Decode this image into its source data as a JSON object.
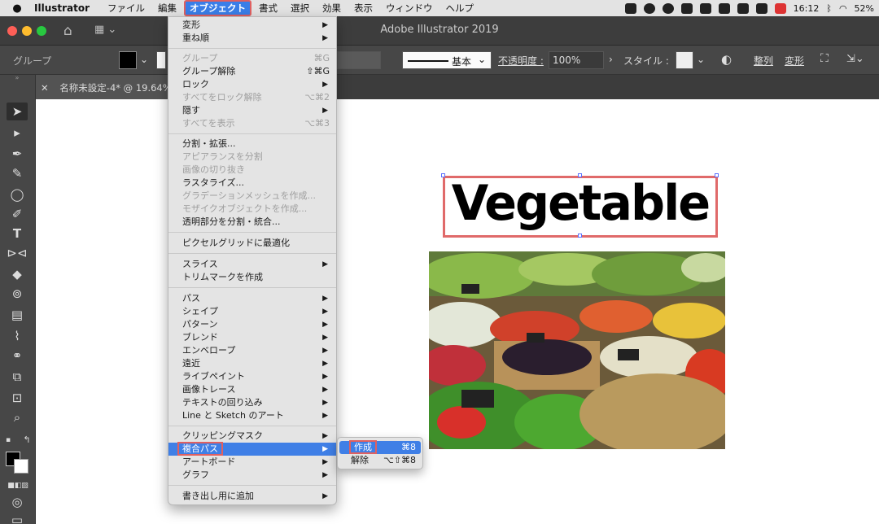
{
  "menubar": {
    "app_name": "Illustrator",
    "items": [
      "ファイル",
      "編集",
      "オブジェクト",
      "書式",
      "選択",
      "効果",
      "表示",
      "ウィンドウ",
      "ヘルプ"
    ],
    "active_item": "オブジェクト",
    "clock": "16:12",
    "battery": "52%"
  },
  "window": {
    "title": "Adobe Illustrator 2019"
  },
  "control_bar": {
    "selection_type": "グループ",
    "stroke_profile": "基本",
    "opacity_label": "不透明度 :",
    "opacity_value": "100%",
    "style_label": "スタイル :",
    "align_label": "整列",
    "transform_label": "変形"
  },
  "document_tab": {
    "title": "名称未設定-4* @ 19.64%"
  },
  "artboard": {
    "headline": "Vegetable",
    "photo_alt": "vegetable-market-photo"
  },
  "object_menu": {
    "items": [
      {
        "label": "変形",
        "submenu": true,
        "enabled": true
      },
      {
        "label": "重ね順",
        "submenu": true,
        "enabled": true
      },
      {
        "label": "グループ",
        "shortcut": "⌘G",
        "enabled": false
      },
      {
        "label": "グループ解除",
        "shortcut": "⇧⌘G",
        "enabled": true
      },
      {
        "label": "ロック",
        "submenu": true,
        "enabled": true
      },
      {
        "label": "すべてをロック解除",
        "shortcut": "⌥⌘2",
        "enabled": false
      },
      {
        "label": "隠す",
        "submenu": true,
        "enabled": true
      },
      {
        "label": "すべてを表示",
        "shortcut": "⌥⌘3",
        "enabled": false
      },
      {
        "label": "分割・拡張...",
        "enabled": true
      },
      {
        "label": "アピアランスを分割",
        "enabled": false
      },
      {
        "label": "画像の切り抜き",
        "enabled": false
      },
      {
        "label": "ラスタライズ...",
        "enabled": true
      },
      {
        "label": "グラデーションメッシュを作成...",
        "enabled": false
      },
      {
        "label": "モザイクオブジェクトを作成...",
        "enabled": false
      },
      {
        "label": "透明部分を分割・統合...",
        "enabled": true
      },
      {
        "label": "ピクセルグリッドに最適化",
        "enabled": true
      },
      {
        "label": "スライス",
        "submenu": true,
        "enabled": true
      },
      {
        "label": "トリムマークを作成",
        "enabled": true
      },
      {
        "label": "パス",
        "submenu": true,
        "enabled": true
      },
      {
        "label": "シェイプ",
        "submenu": true,
        "enabled": true
      },
      {
        "label": "パターン",
        "submenu": true,
        "enabled": true
      },
      {
        "label": "ブレンド",
        "submenu": true,
        "enabled": true
      },
      {
        "label": "エンベロープ",
        "submenu": true,
        "enabled": true
      },
      {
        "label": "遠近",
        "submenu": true,
        "enabled": true
      },
      {
        "label": "ライブペイント",
        "submenu": true,
        "enabled": true
      },
      {
        "label": "画像トレース",
        "submenu": true,
        "enabled": true
      },
      {
        "label": "テキストの回り込み",
        "submenu": true,
        "enabled": true
      },
      {
        "label": "Line と Sketch のアート",
        "submenu": true,
        "enabled": true
      },
      {
        "label": "クリッピングマスク",
        "submenu": true,
        "enabled": true
      },
      {
        "label": "複合パス",
        "submenu": true,
        "enabled": true,
        "highlighted": true
      },
      {
        "label": "アートボード",
        "submenu": true,
        "enabled": true
      },
      {
        "label": "グラフ",
        "submenu": true,
        "enabled": true
      },
      {
        "label": "書き出し用に追加",
        "submenu": true,
        "enabled": true
      }
    ]
  },
  "compound_path_submenu": {
    "items": [
      {
        "label": "作成",
        "shortcut": "⌘8",
        "highlighted": true
      },
      {
        "label": "解除",
        "shortcut": "⌥⇧⌘8"
      }
    ]
  },
  "colors": {
    "menu_highlight": "#3f7fe6",
    "annotation_red": "#e06060",
    "disabled_text": "#9e9e9e"
  }
}
